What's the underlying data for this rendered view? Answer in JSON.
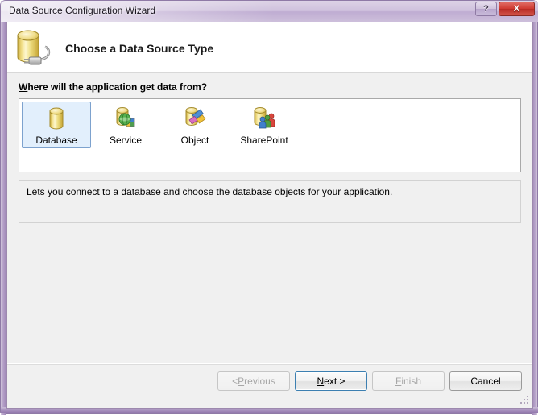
{
  "window": {
    "title": "Data Source Configuration Wizard",
    "help_button_label": "?",
    "close_button_label": "X",
    "help_icon_name": "question-mark-icon",
    "close_icon_name": "close-x-icon"
  },
  "banner": {
    "heading": "Choose a Data Source Type",
    "icon_name": "database-with-plug-icon"
  },
  "body": {
    "prompt_accesskey": "W",
    "prompt_rest": "here will the application get data from?",
    "sources": [
      {
        "label": "Database",
        "icon_name": "database-cylinder-icon",
        "selected": true
      },
      {
        "label": "Service",
        "icon_name": "database-globe-service-icon",
        "selected": false
      },
      {
        "label": "Object",
        "icon_name": "object-diamonds-icon",
        "selected": false
      },
      {
        "label": "SharePoint",
        "icon_name": "database-sharepoint-people-icon",
        "selected": false
      }
    ],
    "description": "Lets you connect to a database and choose the database objects for your application."
  },
  "footer": {
    "buttons": [
      {
        "name": "previous",
        "prefix": "< ",
        "accesskey": "P",
        "suffix": "revious",
        "state": "disabled"
      },
      {
        "name": "next",
        "prefix": "",
        "accesskey": "N",
        "suffix": "ext >",
        "state": "default"
      },
      {
        "name": "finish",
        "prefix": "",
        "accesskey": "F",
        "suffix": "inish",
        "state": "disabled"
      },
      {
        "name": "cancel",
        "prefix": "",
        "accesskey": "",
        "suffix": "Cancel",
        "state": "normal"
      }
    ],
    "resize_grip_name": "resize-grip"
  },
  "colors": {
    "frame": "#b7a3c9",
    "selection": "#e2effc",
    "selection_border": "#7da2ce",
    "default_button_border": "#3c7fb1",
    "close_button": "#cf3b33"
  }
}
